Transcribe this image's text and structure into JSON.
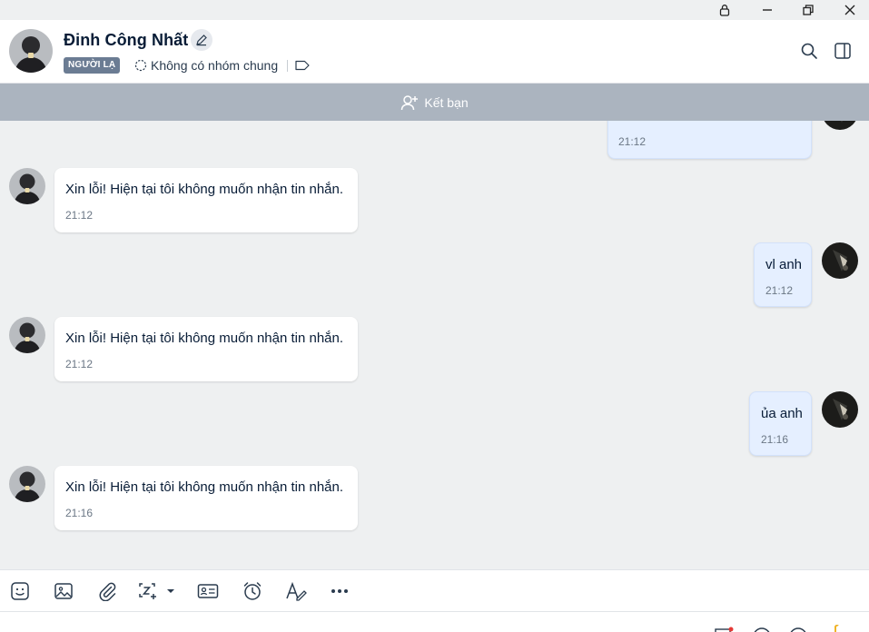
{
  "window": {
    "controls": [
      "lock-icon",
      "minimize-icon",
      "restore-icon",
      "close-icon"
    ]
  },
  "header": {
    "name": "Đinh Công Nhất",
    "badge": "NGƯỜI LẠ",
    "group_info": "Không có nhóm chung"
  },
  "friend_bar": {
    "label": "Kết bạn"
  },
  "messages": [
    {
      "side": "out",
      "text": "",
      "time": "21:12"
    },
    {
      "side": "in",
      "text": "Xin lỗi! Hiện tại tôi không muốn nhận tin nhắn.",
      "time": "21:12"
    },
    {
      "side": "out",
      "text": "vl anh",
      "time": "21:12"
    },
    {
      "side": "in",
      "text": "Xin lỗi! Hiện tại tôi không muốn nhận tin nhắn.",
      "time": "21:12"
    },
    {
      "side": "out",
      "text": "ủa anh",
      "time": "21:16"
    },
    {
      "side": "in",
      "text": "Xin lỗi! Hiện tại tôi không muốn nhận tin nhắn.",
      "time": "21:16"
    }
  ],
  "toolbar": {
    "tools": [
      "sticker-icon",
      "image-icon",
      "attachment-icon",
      "screenshot-icon",
      "business-card-icon",
      "reminder-icon",
      "text-format-icon",
      "more-icon"
    ]
  },
  "colors": {
    "accent": "#005ae0",
    "friend_bar": "#abb4bf",
    "outgoing_bubble": "#e5efff",
    "incoming_bubble": "#ffffff",
    "chat_background": "#eef0f1"
  }
}
